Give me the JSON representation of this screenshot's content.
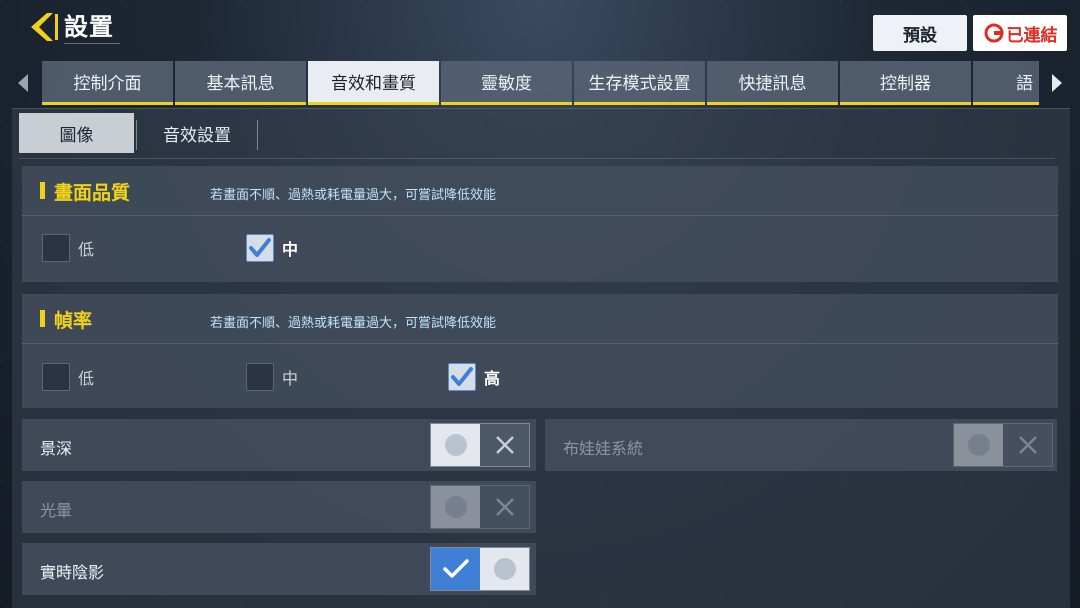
{
  "header": {
    "title": "設置",
    "preset_label": "預設",
    "linked_label": "已連結"
  },
  "tabs": [
    {
      "label": "控制介面",
      "active": false
    },
    {
      "label": "基本訊息",
      "active": false
    },
    {
      "label": "音效和畫質",
      "active": true
    },
    {
      "label": "靈敏度",
      "active": false
    },
    {
      "label": "生存模式設置",
      "active": false
    },
    {
      "label": "快捷訊息",
      "active": false
    },
    {
      "label": "控制器",
      "active": false
    },
    {
      "label": "語",
      "active": false
    }
  ],
  "subtabs": [
    {
      "label": "圖像",
      "active": true
    },
    {
      "label": "音效設置",
      "active": false
    }
  ],
  "quality": {
    "title": "畫面品質",
    "hint": "若畫面不順、過熱或耗電量過大，可嘗試降低效能",
    "options": [
      {
        "label": "低",
        "checked": false
      },
      {
        "label": "中",
        "checked": true
      }
    ]
  },
  "framerate": {
    "title": "幀率",
    "hint": "若畫面不順、過熱或耗電量過大，可嘗試降低效能",
    "options": [
      {
        "label": "低",
        "checked": false
      },
      {
        "label": "中",
        "checked": false
      },
      {
        "label": "高",
        "checked": true
      }
    ]
  },
  "toggles": {
    "depth_of_field": {
      "label": "景深",
      "on": false
    },
    "ragdoll": {
      "label": "布娃娃系統",
      "on": false
    },
    "bloom": {
      "label": "光暈",
      "on": false
    },
    "realtime_shadow": {
      "label": "實時陰影",
      "on": true
    }
  },
  "colors": {
    "accent_yellow": "#f1d21a",
    "toggle_on_blue": "#3f7fd6",
    "link_red": "#e02a24"
  }
}
